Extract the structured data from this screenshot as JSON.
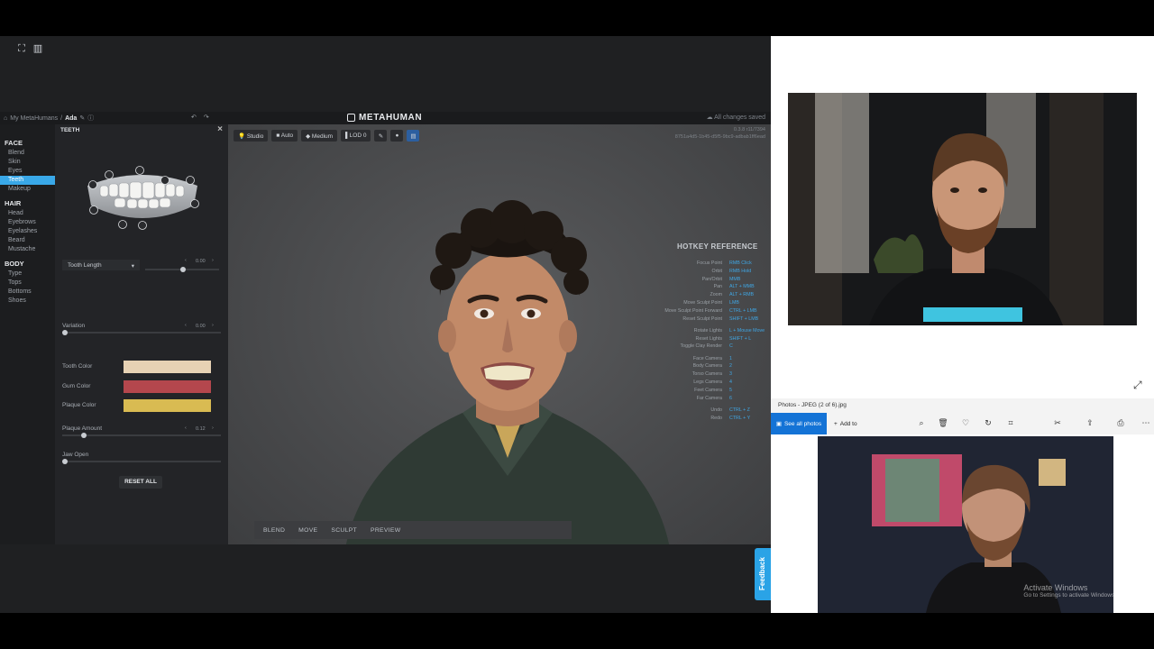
{
  "metahuman": {
    "breadcrumb": {
      "root": "My MetaHumans",
      "separator": "/",
      "current": "Ada"
    },
    "logo_text": "METAHUMAN",
    "save_status": "All changes saved",
    "viewport_info": [
      "0.3.8 r11/7394",
      "8751a4d5-1b45-d5f5-9bc9-adbab1ff6ead"
    ],
    "sidenav": [
      {
        "heading": "FACE",
        "items": [
          "Blend",
          "Skin",
          "Eyes",
          "Teeth",
          "Makeup"
        ]
      },
      {
        "heading": "HAIR",
        "items": [
          "Head",
          "Eyebrows",
          "Eyelashes",
          "Beard",
          "Mustache"
        ]
      },
      {
        "heading": "BODY",
        "items": [
          "Type",
          "Tops",
          "Bottoms",
          "Shoes"
        ]
      }
    ],
    "active_nav": "Teeth",
    "panel": {
      "title": "TEETH",
      "dropdown_label": "Tooth Length",
      "tooth_length_value": "0.00",
      "variation_label": "Variation",
      "variation_value": "0.00",
      "tooth_color_label": "Tooth Color",
      "gum_color_label": "Gum Color",
      "plaque_color_label": "Plaque Color",
      "plaque_amount_label": "Plaque Amount",
      "plaque_amount_value": "0.12",
      "jaw_open_label": "Jaw Open",
      "reset_label": "RESET ALL",
      "colors": {
        "tooth": "#e7d2b4",
        "gum": "#b4474d",
        "plaque": "#d9bb52"
      }
    },
    "toolbar": {
      "studio": "Studio",
      "auto": "Auto",
      "medium": "Medium",
      "lod": "LOD 0"
    },
    "hotkeys": {
      "title": "HOTKEY REFERENCE",
      "entries": [
        {
          "action": "Focus Point",
          "keys": "RMB Click"
        },
        {
          "action": "Orbit",
          "keys": "RMB Hold"
        },
        {
          "action": "Pan/Orbit",
          "keys": "MMB"
        },
        {
          "action": "Pan",
          "keys": "ALT + MMB"
        },
        {
          "action": "Zoom",
          "keys": "ALT + RMB"
        },
        {
          "action": "Move Sculpt Point",
          "keys": "LMB"
        },
        {
          "action": "Move Sculpt Point Forward",
          "keys": "CTRL + LMB"
        },
        {
          "action": "Reset Sculpt Point",
          "keys": "SHIFT + LMB"
        },
        {
          "action": "Rotate Lights",
          "keys": "L + Mouse Move"
        },
        {
          "action": "Reset Lights",
          "keys": "SHIFT + L"
        },
        {
          "action": "Toggle Clay Render",
          "keys": "C"
        },
        {
          "action": "Face Camera",
          "keys": "1"
        },
        {
          "action": "Body Camera",
          "keys": "2"
        },
        {
          "action": "Torso Camera",
          "keys": "3"
        },
        {
          "action": "Legs Camera",
          "keys": "4"
        },
        {
          "action": "Feet Camera",
          "keys": "5"
        },
        {
          "action": "Far Camera",
          "keys": "6"
        },
        {
          "action": "Undo",
          "keys": "CTRL + Z"
        },
        {
          "action": "Redo",
          "keys": "CTRL + Y"
        }
      ]
    },
    "bottom_tabs": [
      "BLEND",
      "MOVE",
      "SCULPT",
      "PREVIEW"
    ]
  },
  "photos_app": {
    "title": "Photos - JPEG (2 of 6).jpg",
    "see_all_label": "See all photos",
    "add_to_label": "Add to",
    "watermark_line1": "Activate Windows",
    "watermark_line2": "Go to Settings to activate Windows."
  },
  "feedback_label": "Feedback"
}
